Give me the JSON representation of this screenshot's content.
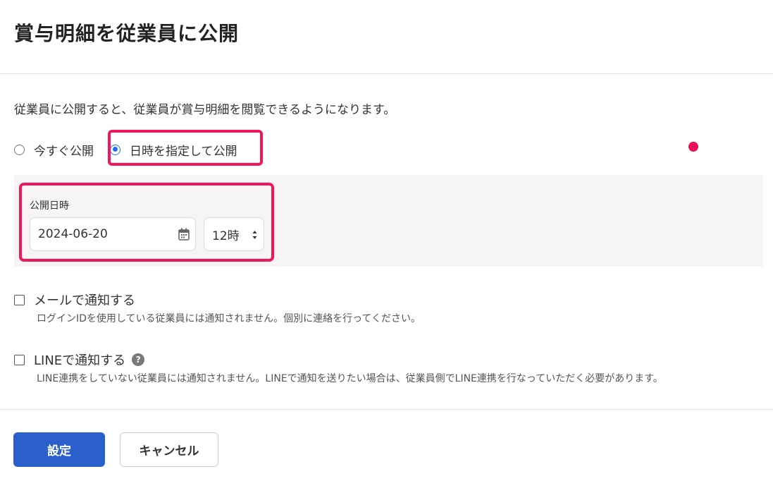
{
  "dialog": {
    "title": "賞与明細を従業員に公開",
    "description": "従業員に公開すると、従業員が賞与明細を閲覧できるようになります。"
  },
  "publish_options": [
    {
      "label": "今すぐ公開",
      "selected": false
    },
    {
      "label": "日時を指定して公開",
      "selected": true
    }
  ],
  "schedule": {
    "label": "公開日時",
    "date_value": "2024-06-20",
    "hour_value": "12時"
  },
  "notifications": {
    "email": {
      "label": "メールで通知する",
      "checked": false,
      "note": "ログインIDを使用している従業員には通知されません。個別に連絡を行ってください。"
    },
    "line": {
      "label": "LINEで通知する",
      "checked": false,
      "help_glyph": "?",
      "note": "LINE連携をしていない従業員には通知されません。LINEで通知を送りたい場合は、従業員側でLINE連携を行なっていただく必要があります。"
    }
  },
  "actions": {
    "confirm_label": "設定",
    "cancel_label": "キャンセル"
  },
  "colors": {
    "primary": "#2a5fcc",
    "highlight": "#f0155d",
    "radio_selected": "#1a73e8",
    "panel_bg": "#f6f4f4"
  },
  "icons": {
    "date_field": "calendar-icon",
    "hour_field": "spinner-icon",
    "line_help": "help-icon"
  }
}
